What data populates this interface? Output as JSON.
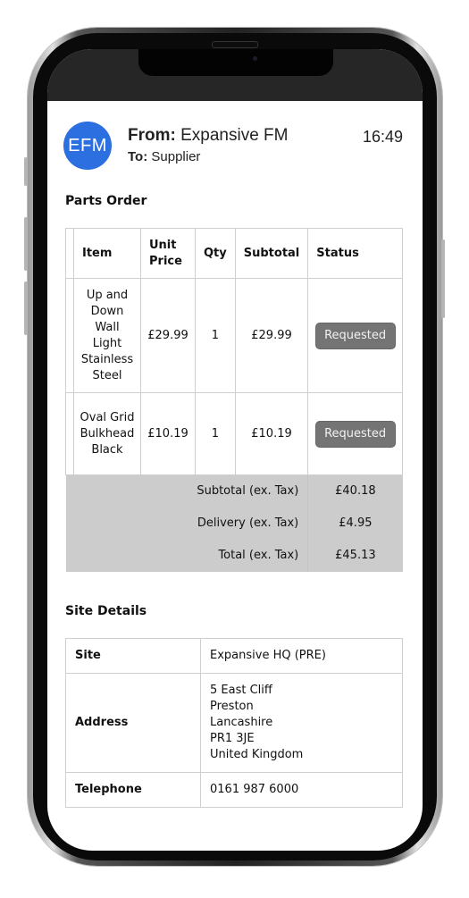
{
  "email": {
    "avatar_initials": "EFM",
    "avatar_color": "#2b6fe0",
    "from_label": "From:",
    "from_value": "Expansive FM",
    "to_label": "To:",
    "to_value": "Supplier",
    "time": "16:49"
  },
  "parts_order": {
    "title": "Parts Order",
    "columns": [
      "",
      "Item",
      "Unit Price",
      "Qty",
      "Subtotal",
      "Status"
    ],
    "rows": [
      {
        "item": "Up and Down Wall Light Stainless Steel",
        "unit_price": "£29.99",
        "qty": "1",
        "subtotal": "£29.99",
        "status": "Requested"
      },
      {
        "item": "Oval Grid Bulkhead Black",
        "unit_price": "£10.19",
        "qty": "1",
        "subtotal": "£10.19",
        "status": "Requested"
      }
    ],
    "totals": [
      {
        "label": "Subtotal (ex. Tax)",
        "value": "£40.18"
      },
      {
        "label": "Delivery (ex. Tax)",
        "value": "£4.95"
      },
      {
        "label": "Total (ex. Tax)",
        "value": "£45.13"
      }
    ]
  },
  "site_details": {
    "title": "Site Details",
    "site_label": "Site",
    "site_value": "Expansive HQ (PRE)",
    "address_label": "Address",
    "address_lines": [
      "5 East Cliff",
      "Preston",
      "Lancashire",
      "PR1 3JE",
      "United Kingdom"
    ],
    "telephone_label": "Telephone",
    "telephone_value": "0161 987 6000"
  }
}
